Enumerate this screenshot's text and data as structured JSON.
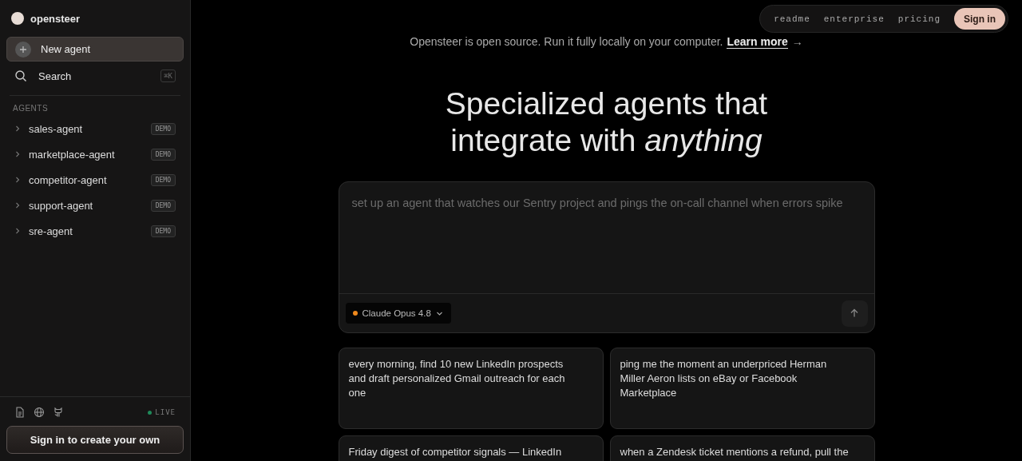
{
  "brand": {
    "name": "opensteer"
  },
  "sidebar": {
    "new_button": "New agent",
    "search": {
      "label": "Search",
      "shortcut": "⌘K"
    },
    "section_label": "AGENTS",
    "agents": [
      {
        "name": "sales-agent",
        "badge": "DEMO",
        "expanded": false
      },
      {
        "name": "marketplace-agent",
        "badge": "DEMO",
        "expanded": false
      },
      {
        "name": "competitor-agent",
        "badge": "DEMO",
        "expanded": false
      },
      {
        "name": "support-agent",
        "badge": "DEMO",
        "expanded": false
      },
      {
        "name": "sre-agent",
        "badge": "DEMO",
        "expanded": false
      }
    ],
    "status": {
      "label": "LIVE",
      "color": "#1f8a5a"
    },
    "sign_in_button": "Sign in to create your own"
  },
  "nav": {
    "links": [
      "readme",
      "enterprise",
      "pricing"
    ],
    "sign_in": "Sign in"
  },
  "banner": {
    "text": "Opensteer is open source. Run it fully locally on your computer.",
    "link": "Learn more",
    "arrow": "→"
  },
  "hero": {
    "line1": "Specialized agents that",
    "line2": "integrate with *anything*"
  },
  "composer": {
    "placeholder": "set up an agent that watches our Sentry project and pings the on-call channel when errors spike",
    "model": {
      "name": "Claude Opus 4.8",
      "color": "#f0891c"
    }
  },
  "suggestions": [
    "every morning, find 10 new LinkedIn prospects and draft personalized Gmail outreach for each one",
    "ping me the moment an underpriced Herman Miller Aeron lists on eBay or Facebook Marketplace",
    "Friday digest of competitor signals — LinkedIn",
    "when a Zendesk ticket mentions a refund, pull the"
  ]
}
